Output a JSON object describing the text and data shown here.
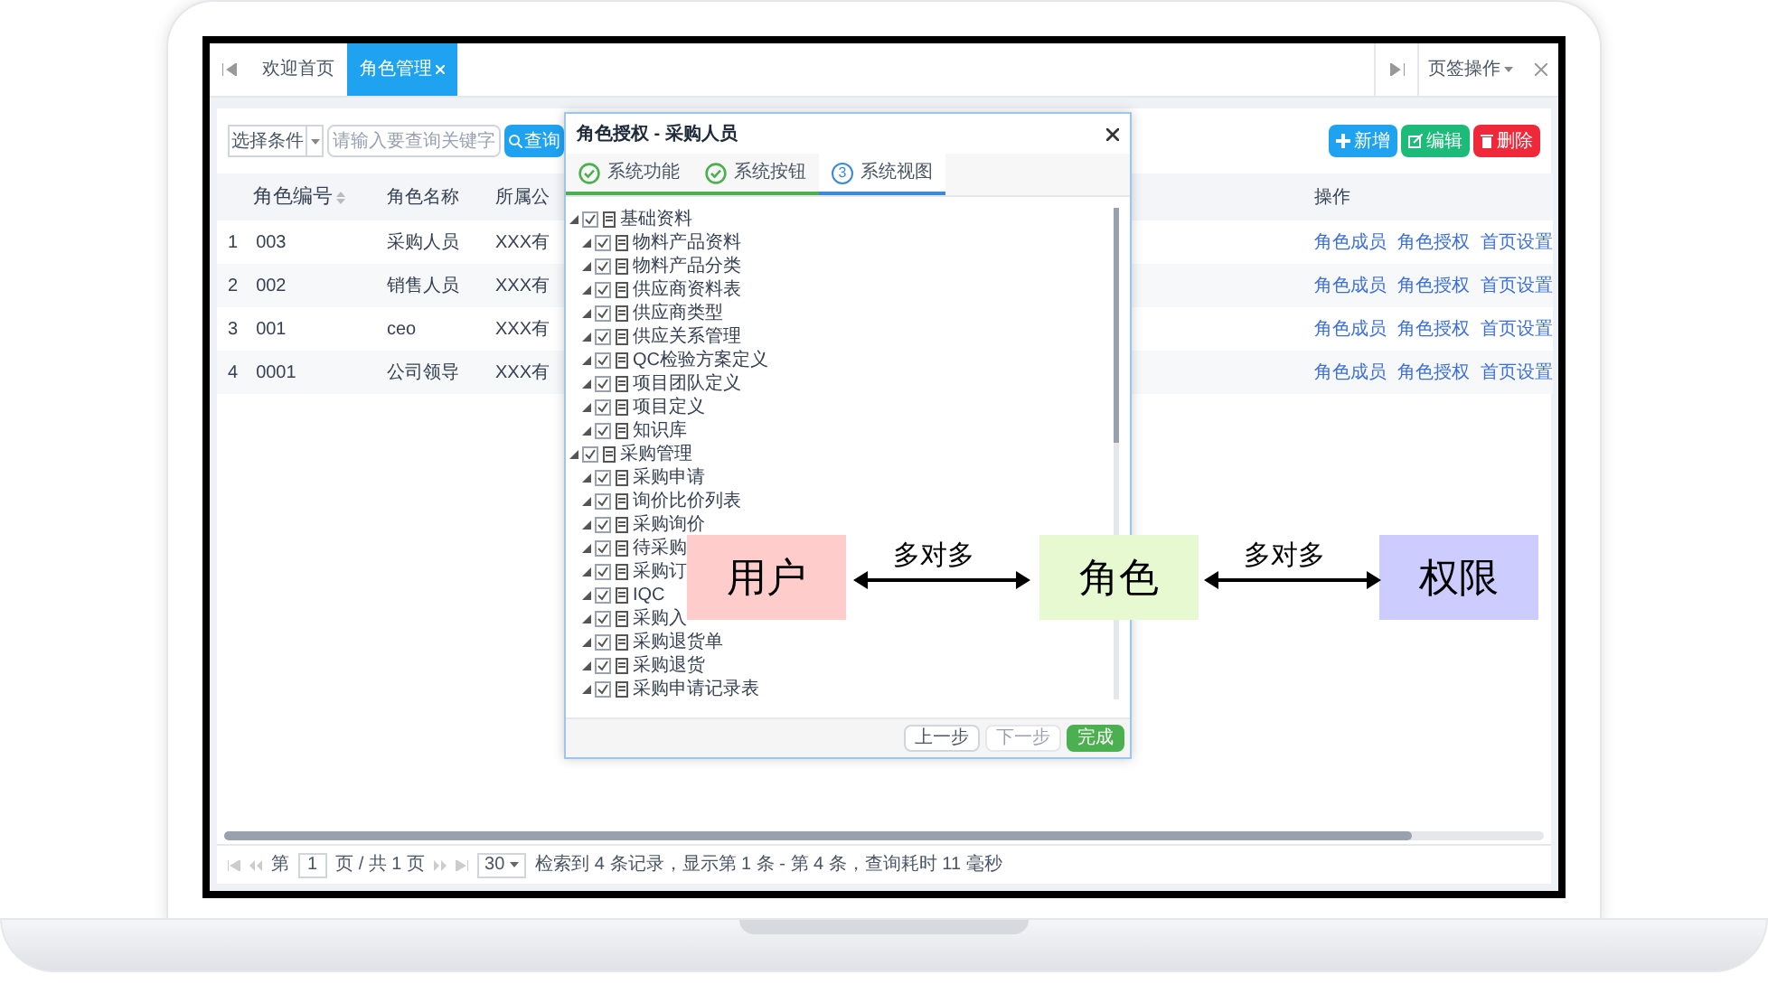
{
  "tabs": [
    {
      "label": "欢迎首页",
      "selected": false
    },
    {
      "label": "角色管理",
      "selected": true,
      "closable": true
    }
  ],
  "tab_actions": {
    "label": "页签操作"
  },
  "search": {
    "condition": "选择条件",
    "placeholder": "请输入要查询关键字",
    "button": "查询"
  },
  "toolbar": [
    {
      "label": "新增",
      "kind": "add"
    },
    {
      "label": "编辑",
      "kind": "edit"
    },
    {
      "label": "删除",
      "kind": "delete"
    }
  ],
  "table": {
    "columns": [
      "角色编号",
      "角色名称",
      "所属公",
      "操作"
    ],
    "rows": [
      {
        "index": "1",
        "code": "003",
        "name": "采购人员",
        "company": "XXX有",
        "actions": [
          "角色成员",
          "角色授权",
          "首页设置"
        ]
      },
      {
        "index": "2",
        "code": "002",
        "name": "销售人员",
        "company": "XXX有",
        "actions": [
          "角色成员",
          "角色授权",
          "首页设置"
        ]
      },
      {
        "index": "3",
        "code": "001",
        "name": "ceo",
        "company": "XXX有",
        "actions": [
          "角色成员",
          "角色授权",
          "首页设置"
        ]
      },
      {
        "index": "4",
        "code": "0001",
        "name": "公司领导",
        "company": "XXX有",
        "actions": [
          "角色成员",
          "角色授权",
          "首页设置"
        ]
      }
    ]
  },
  "pagination": {
    "page_prefix": "第",
    "page": "1",
    "page_suffix": "页 / 共 1 页",
    "page_size": "30",
    "summary": "检索到 4 条记录，显示第 1 条 - 第 4 条，查询耗时 11 毫秒"
  },
  "dialog": {
    "title": "角色授权 - 采购人员",
    "steps": [
      {
        "label": "系统功能",
        "done": true,
        "selected": false
      },
      {
        "label": "系统按钮",
        "done": true,
        "selected": false
      },
      {
        "label": "系统视图",
        "done": false,
        "selected": true,
        "number": "3"
      }
    ],
    "tree": [
      {
        "label": "基础资料",
        "checked": true,
        "expanded": true,
        "children": [
          {
            "label": "物料产品资料",
            "checked": true
          },
          {
            "label": "物料产品分类",
            "checked": true
          },
          {
            "label": "供应商资料表",
            "checked": true
          },
          {
            "label": "供应商类型",
            "checked": true
          },
          {
            "label": "供应关系管理",
            "checked": true
          },
          {
            "label": "QC检验方案定义",
            "checked": true
          },
          {
            "label": "项目团队定义",
            "checked": true
          },
          {
            "label": "项目定义",
            "checked": true
          },
          {
            "label": "知识库",
            "checked": true
          }
        ]
      },
      {
        "label": "采购管理",
        "checked": true,
        "expanded": true,
        "children": [
          {
            "label": "采购申请",
            "checked": true
          },
          {
            "label": "询价比价列表",
            "checked": true
          },
          {
            "label": "采购询价",
            "checked": true
          },
          {
            "label": "待采购",
            "checked": true
          },
          {
            "label": "采购订",
            "checked": true
          },
          {
            "label": "IQC",
            "checked": true
          },
          {
            "label": "采购入",
            "checked": true
          },
          {
            "label": "采购退货单",
            "checked": true
          },
          {
            "label": "采购退货",
            "checked": true
          },
          {
            "label": "采购申请记录表",
            "checked": true
          }
        ]
      }
    ],
    "buttons": [
      {
        "label": "上一步",
        "kind": "prev",
        "disabled": false
      },
      {
        "label": "下一步",
        "kind": "next",
        "disabled": true
      },
      {
        "label": "完成",
        "kind": "finish",
        "disabled": false
      }
    ]
  },
  "diagram": {
    "nodes": [
      {
        "label": "用户",
        "color": "#ffcccc"
      },
      {
        "label": "角色",
        "color": "#e6f9d0"
      },
      {
        "label": "权限",
        "color": "#ccccff"
      }
    ],
    "links": [
      {
        "label": "多对多"
      },
      {
        "label": "多对多"
      }
    ]
  }
}
